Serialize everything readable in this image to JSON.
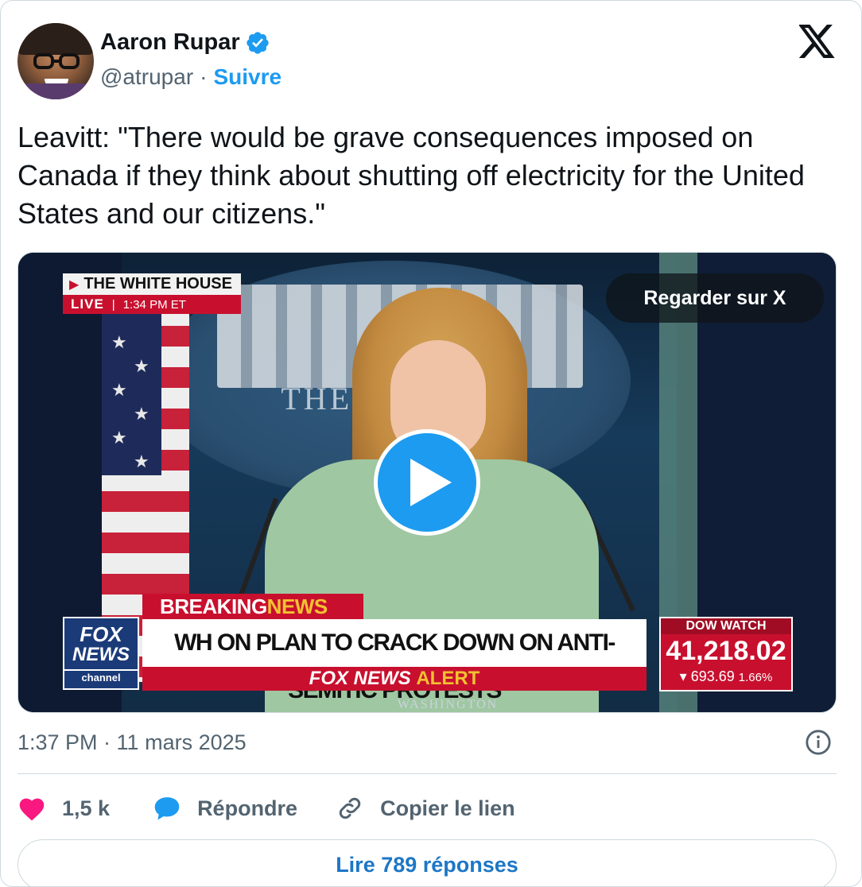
{
  "author": {
    "name": "Aaron Rupar",
    "handle": "@atrupar",
    "separator": "·",
    "follow_label": "Suivre",
    "verified": true
  },
  "brand_icon": "x-logo-icon",
  "tweet": {
    "text": "Leavitt: \"There would be grave consequences imposed on Canada if they think about shutting off electricity for the United States and our citizens.\""
  },
  "video": {
    "watch_label": "Regarder sur X",
    "play_icon": "play-icon",
    "overlay": {
      "wh_bug_title": "THE WHITE HOUSE",
      "wh_bug_live": "LIVE",
      "wh_bug_sep": "|",
      "wh_bug_time": "1:34 PM ET",
      "background_text": "THE WH    USE",
      "breaking_prefix": "BREAKING",
      "breaking_suffix": "NEWS",
      "fox_logo_line1": "FOX",
      "fox_logo_line2": "NEWS",
      "fox_logo_line3": "channel",
      "headline": "WH ON PLAN TO CRACK DOWN ON ANTI-SEMITIC PROTESTS",
      "alert_prefix": "FOX NEWS",
      "alert_suffix": "ALERT",
      "dow_label": "DOW WATCH",
      "dow_value": "41,218.02",
      "dow_change": "693.69",
      "dow_pct": "1.66%",
      "location": "WASHINGTON"
    }
  },
  "meta": {
    "timestamp": "1:37 PM · 11 mars 2025",
    "info_icon": "info-icon"
  },
  "actions": {
    "like_count": "1,5 k",
    "reply_label": "Répondre",
    "copy_link_label": "Copier le lien"
  },
  "replies_button": "Lire 789 réponses",
  "colors": {
    "accent": "#1d9bf0",
    "like": "#f91880",
    "text": "#0f1419",
    "secondary": "#536471",
    "border": "#cfd9de"
  }
}
